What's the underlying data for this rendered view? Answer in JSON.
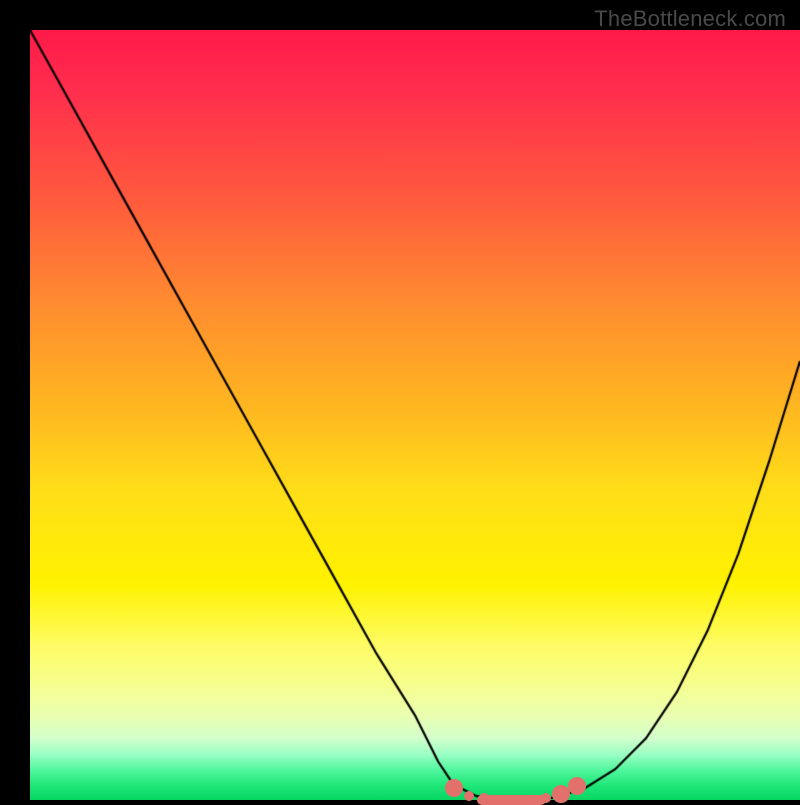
{
  "watermark": "TheBottleneck.com",
  "chart_data": {
    "type": "line",
    "title": "",
    "xlabel": "",
    "ylabel": "",
    "xlim": [
      0,
      100
    ],
    "ylim": [
      0,
      100
    ],
    "series": [
      {
        "name": "curve",
        "x": [
          0,
          5,
          10,
          15,
          20,
          25,
          30,
          35,
          40,
          45,
          50,
          53,
          55,
          58,
          62,
          65,
          68,
          72,
          76,
          80,
          84,
          88,
          92,
          96,
          100
        ],
        "y": [
          100,
          91,
          82,
          73,
          64,
          55,
          46,
          37,
          28,
          19,
          11,
          5,
          2,
          0.5,
          0,
          0,
          0.3,
          1.5,
          4,
          8,
          14,
          22,
          32,
          44,
          57
        ]
      }
    ],
    "optimal_zone": {
      "x_start": 55,
      "x_end": 70,
      "y": 0
    },
    "markers": [
      {
        "x": 55,
        "y": 1.5,
        "size": "large"
      },
      {
        "x": 57,
        "y": 0.5,
        "size": "small"
      },
      {
        "x": 59,
        "y": 0.2,
        "size": "small"
      },
      {
        "x": 61,
        "y": 0,
        "size": "small"
      },
      {
        "x": 63,
        "y": 0,
        "size": "small"
      },
      {
        "x": 65,
        "y": 0,
        "size": "small"
      },
      {
        "x": 67,
        "y": 0.3,
        "size": "small"
      },
      {
        "x": 69,
        "y": 0.8,
        "size": "large"
      },
      {
        "x": 71,
        "y": 1.8,
        "size": "large"
      }
    ],
    "background": {
      "type": "vertical-gradient",
      "stops": [
        {
          "pct": 0,
          "color": "#ff1a4a"
        },
        {
          "pct": 50,
          "color": "#ffde18"
        },
        {
          "pct": 100,
          "color": "#06d662"
        }
      ],
      "meaning": "top=worst (red), bottom=best (green)"
    }
  }
}
